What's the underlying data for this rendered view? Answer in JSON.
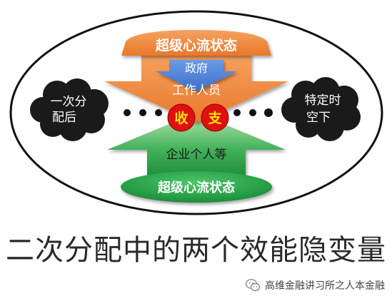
{
  "diagram": {
    "top_banner": "超级心流状态",
    "bottom_banner": "超级心流状态",
    "gov_label": "政府",
    "worker_label": "工作人员",
    "enterprise_label": "企业个人等",
    "left_cloud_line1": "一次分",
    "left_cloud_line2": "配后",
    "right_cloud_line1": "特定时",
    "right_cloud_line2": "空下",
    "circle_income": "收",
    "circle_expense": "支"
  },
  "caption": "二次分配中的两个效能隐变量",
  "watermark": {
    "text": "高维金融讲习所之人本金融",
    "icon": "wechat-icon"
  },
  "colors": {
    "orange": "#f08a3a",
    "blue": "#4a7fd4",
    "green": "#2fa84c",
    "red": "#e01010",
    "yellow": "#ffe500",
    "cloud": "#1a1a1a"
  }
}
